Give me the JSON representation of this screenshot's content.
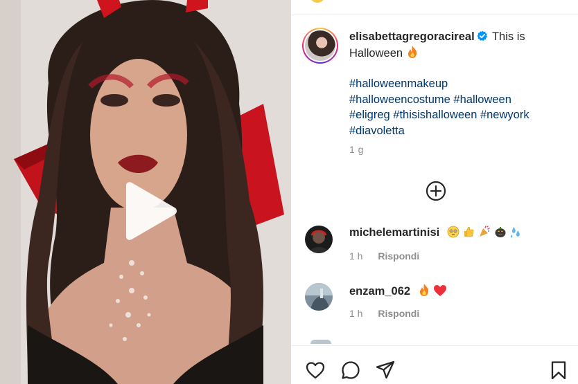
{
  "post": {
    "username": "elisabettagregoracireal",
    "verified": true,
    "caption_text": "This is Halloween",
    "caption_emoji": "fire-icon",
    "hashtags_lines": [
      "#halloweenmakeup",
      "#halloweencostume #halloween",
      "#eligreg #thisishalloween #newyork",
      "#diavoletta"
    ],
    "time_ago": "1 g"
  },
  "comments": [
    {
      "username": "michelemartinisi",
      "emojis": [
        "flushed-face-icon",
        "thumbs-up-icon",
        "party-popper-icon",
        "jack-o-lantern-icon",
        "sweat-droplets-icon"
      ],
      "time": "1 h",
      "reply_label": "Rispondi"
    },
    {
      "username": "enzam_062",
      "emojis": [
        "fire-icon",
        "red-heart-icon"
      ],
      "time": "1 h",
      "reply_label": "Rispondi"
    }
  ],
  "actions": [
    "like-icon",
    "comment-icon",
    "share-icon",
    "save-icon"
  ],
  "colors": {
    "text": "#262626",
    "hashtag": "#00376b",
    "muted": "#8e8e8e",
    "verified": "#0095f6",
    "heart": "#ed2f3c"
  }
}
